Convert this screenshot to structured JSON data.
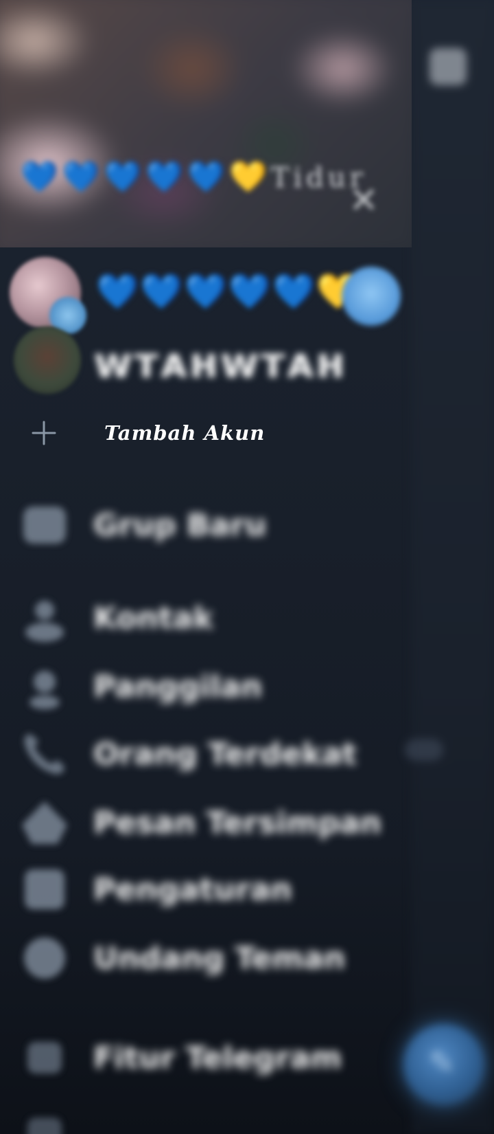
{
  "cover": {
    "hearts_left": "💙💙💙💙💙",
    "hearts_gold": "💛",
    "cover_text": "Tidur",
    "close_glyph": "✕"
  },
  "accounts": [
    {
      "hearts": "💙💙💙💙💙",
      "gold": "💛",
      "avatar_icon": "avatar-couple",
      "checked": true
    },
    {
      "name": "ᴡᴛᴀʜᴡᴛᴀʜ",
      "avatar_icon": "avatar-user"
    }
  ],
  "add_account": {
    "label": "Tambah Akun",
    "icon": "plus-icon"
  },
  "menu": [
    {
      "label": "Grup Baru",
      "icon": "group-icon"
    },
    {
      "label": "Kontak",
      "icon": "contact-icon"
    },
    {
      "label": "Panggilan",
      "icon": "phone-icon"
    },
    {
      "label": "Orang Terdekat",
      "icon": "nearby-icon"
    },
    {
      "label": "Pesan Tersimpan",
      "icon": "bookmark-icon"
    },
    {
      "label": "Pengaturan",
      "icon": "settings-icon"
    },
    {
      "label": "Undang Teman",
      "icon": "invite-icon"
    },
    {
      "label": "Fitur Telegram",
      "icon": "help-icon"
    }
  ],
  "fab": {
    "icon": "pencil-icon"
  },
  "colors": {
    "drawer_bg": "#1a212c",
    "accent": "#5598d8",
    "text": "#ffffff",
    "icon": "#8a97a6"
  }
}
